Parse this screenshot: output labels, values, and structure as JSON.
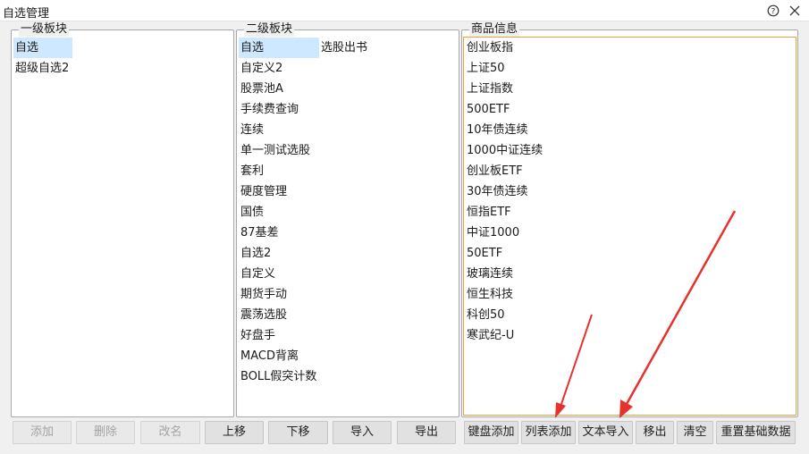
{
  "window": {
    "title": "自选管理",
    "help_icon": "help-icon",
    "close_icon": "close-icon"
  },
  "panel1": {
    "title": "一级板块",
    "items": [
      "自选",
      "超级自选2"
    ],
    "selected_index": 0
  },
  "panel2": {
    "title": "二级板块",
    "items": [
      "自选",
      "自定义2",
      "股票池A",
      "手续费查询",
      "连续",
      "单一测试选股",
      "套利",
      "硬度管理",
      "国债",
      "87基差",
      "自选2",
      "自定义",
      "期货手动",
      "震荡选股",
      "好盘手",
      "MACD背离",
      "BOLL假突计数"
    ],
    "selected_index": 0,
    "extra_label": "选股出书"
  },
  "panel3": {
    "title": "商品信息",
    "items": [
      "创业板指",
      "上证50",
      "上证指数",
      "500ETF",
      "10年债连续",
      "1000中证连续",
      "创业板ETF",
      "30年债连续",
      "恒指ETF",
      "中证1000",
      "50ETF",
      "玻璃连续",
      "恒生科技",
      "科创50",
      "寒武纪-U"
    ]
  },
  "buttons_left": [
    {
      "label": "添加",
      "enabled": false
    },
    {
      "label": "删除",
      "enabled": false
    },
    {
      "label": "改名",
      "enabled": false
    },
    {
      "label": "上移",
      "enabled": true
    },
    {
      "label": "下移",
      "enabled": true
    },
    {
      "label": "导入",
      "enabled": true
    },
    {
      "label": "导出",
      "enabled": true
    }
  ],
  "buttons_right": [
    {
      "label": "键盘添加",
      "enabled": true
    },
    {
      "label": "列表添加",
      "enabled": true
    },
    {
      "label": "文本导入",
      "enabled": true
    },
    {
      "label": "移出",
      "enabled": true
    },
    {
      "label": "清空",
      "enabled": true
    },
    {
      "label": "重置基础数据",
      "enabled": true
    }
  ],
  "colors": {
    "selection": "#cde8ff",
    "focus_border": "#e6a23c",
    "arrow": "#e5322d"
  }
}
